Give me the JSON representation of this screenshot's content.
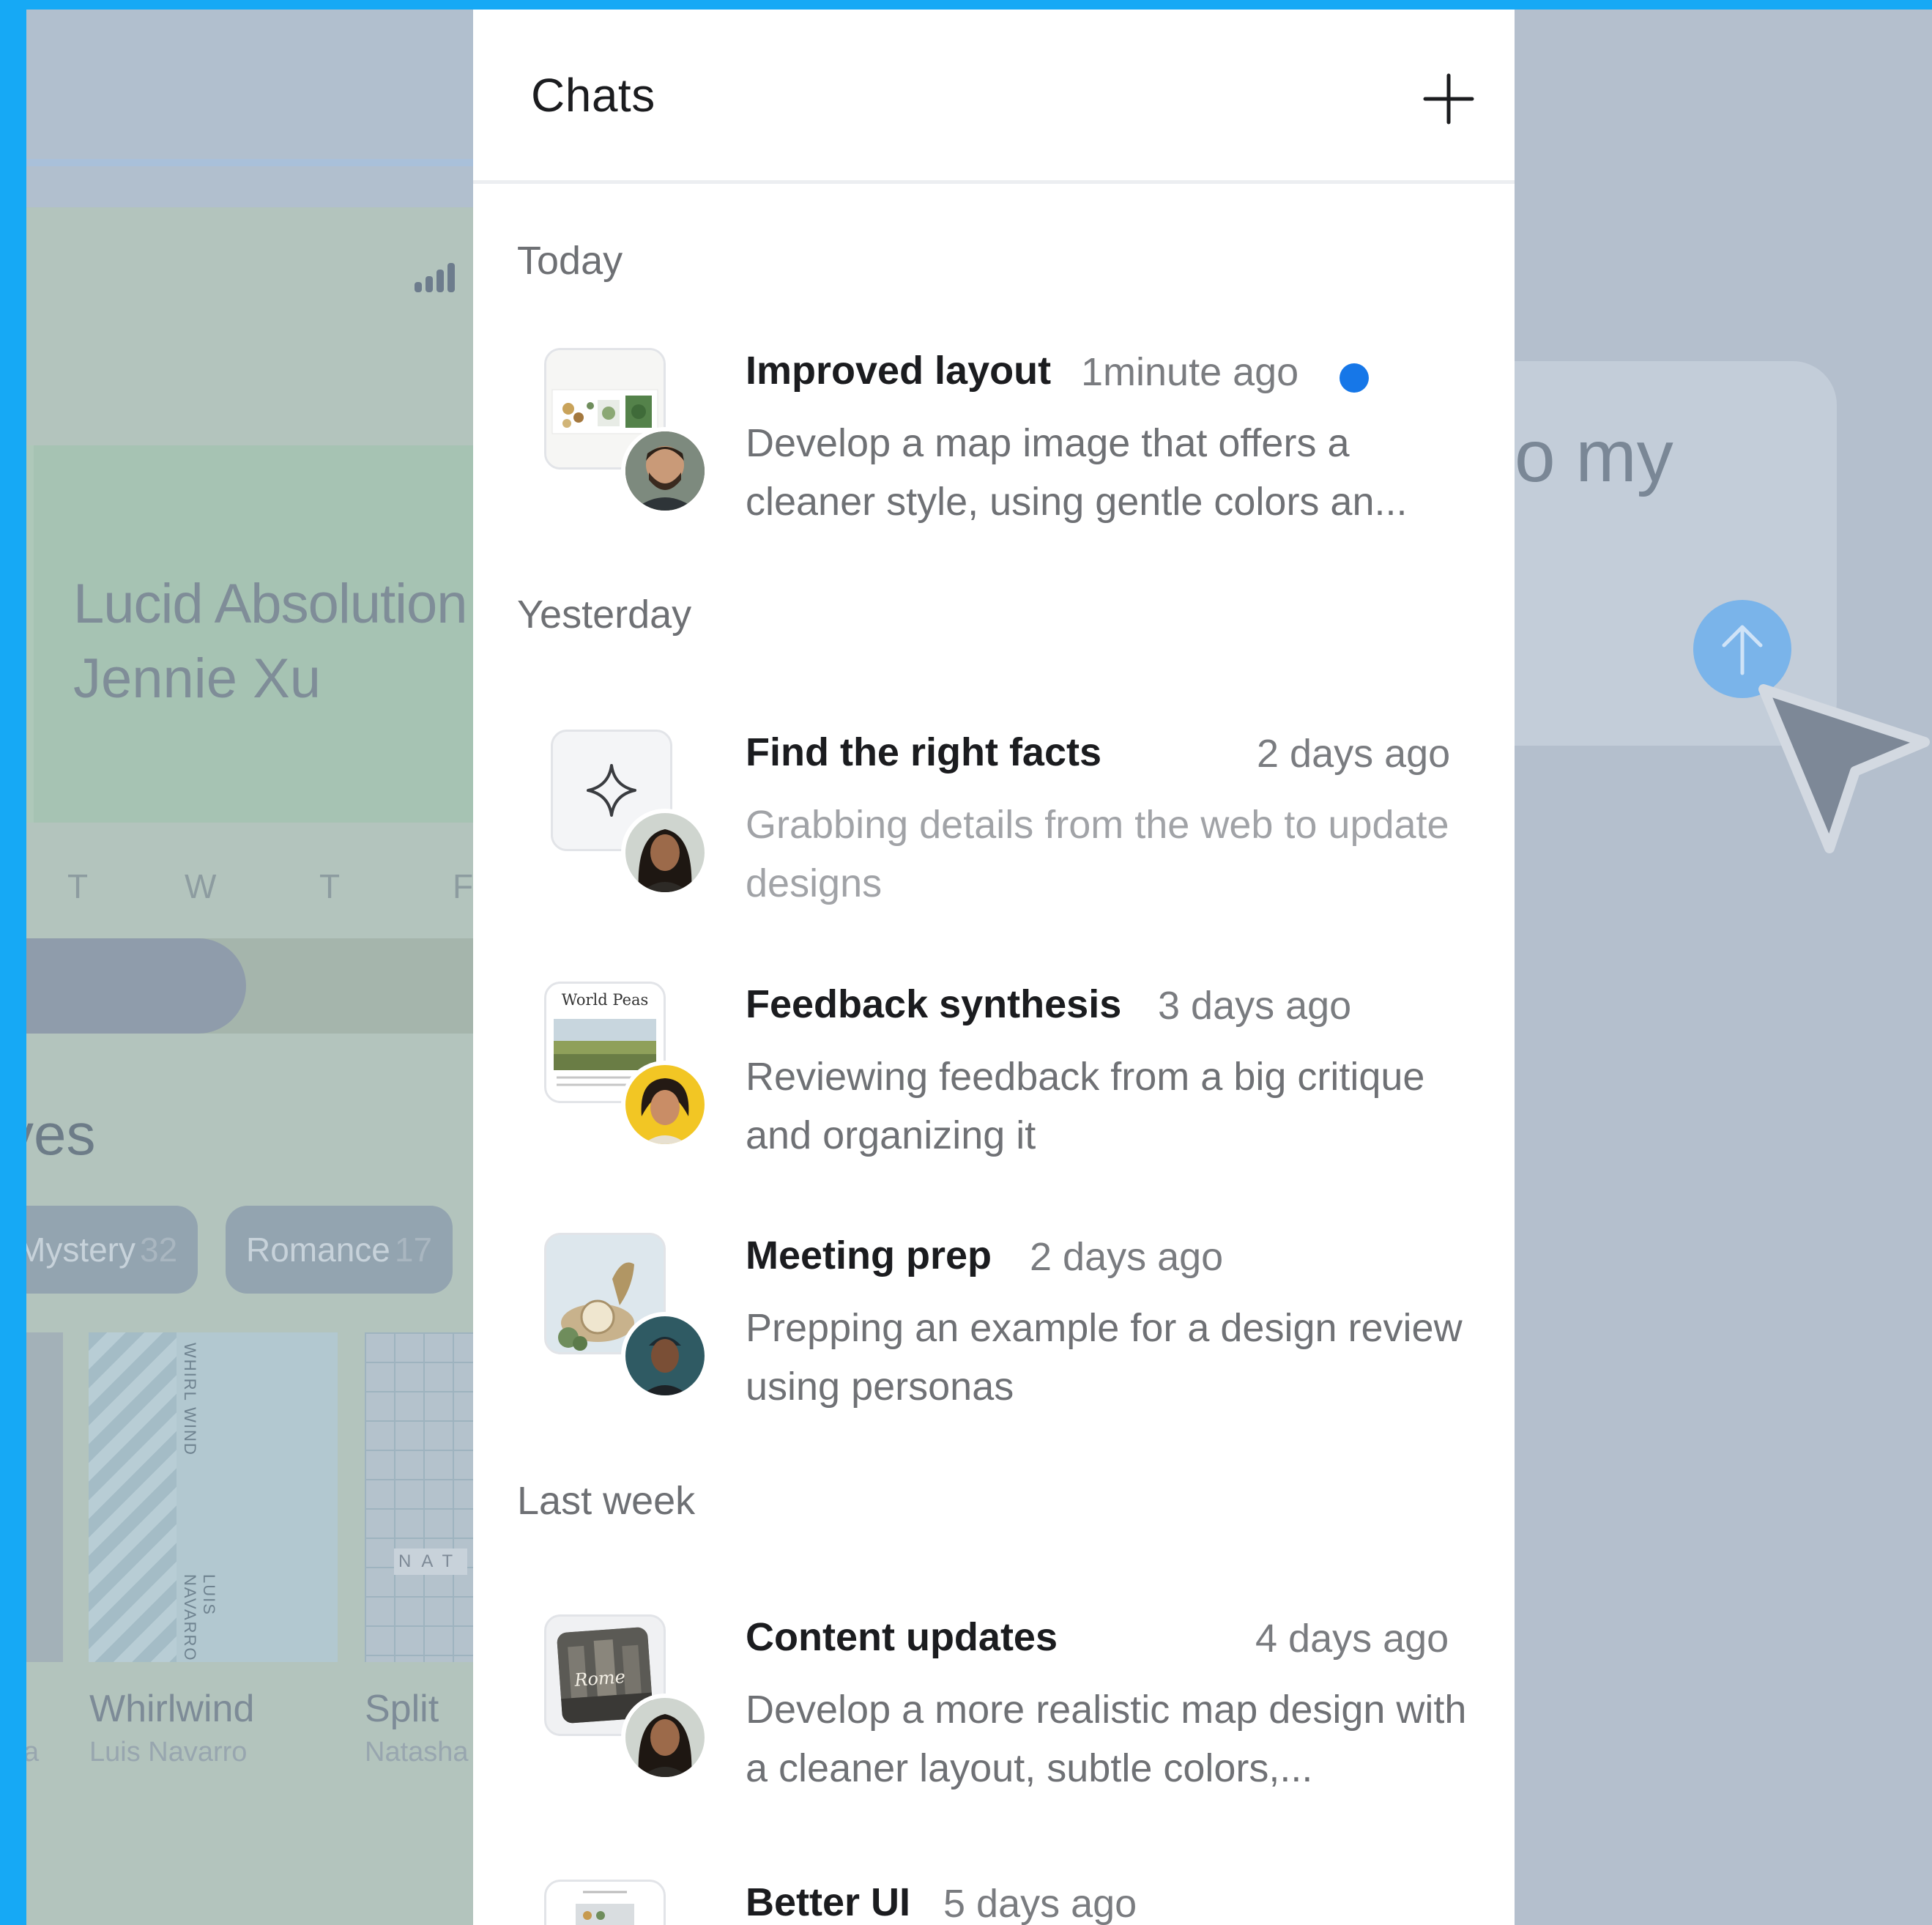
{
  "colors": {
    "frame": "#16a9f5",
    "unread": "#1677e8",
    "panel_bg": "#ffffff",
    "title_text": "#1b1c1f",
    "secondary_text": "#6f7175"
  },
  "background_left": {
    "book_title": "Lucid Absolution",
    "book_author": "Jennie Xu",
    "weekdays": [
      "T",
      "W",
      "T",
      "F"
    ],
    "shelf_heading": "ves",
    "chips": [
      {
        "label": "Mystery",
        "count": "32"
      },
      {
        "label": "Romance",
        "count": "17"
      }
    ],
    "books": [
      {
        "title": "Whirlwind",
        "author": "Luis Navarro",
        "spine_top": "WHIRL WIND",
        "spine_bottom": "LUIS NAVARRO"
      },
      {
        "title": "Split",
        "author": "Natasha",
        "cover_text": "NAT"
      }
    ],
    "left_fragment": "a"
  },
  "background_right": {
    "composer_text": "o my",
    "send_icon": "arrow-up-icon",
    "cursor_icon": "pointer-cursor-icon"
  },
  "panel": {
    "title": "Chats",
    "new_chat_icon": "plus-icon",
    "sections": [
      {
        "label": "Today",
        "items": [
          {
            "title": "Improved layout",
            "time": "1minute ago",
            "unread": true,
            "description": "Develop a map image that offers a cleaner style, using gentle colors an..."
          }
        ]
      },
      {
        "label": "Yesterday",
        "items": [
          {
            "title": "Find the right facts",
            "time": "2 days ago",
            "unread": false,
            "description": "Grabbing details from the web to update designs"
          },
          {
            "title": "Feedback synthesis",
            "time": "3 days ago",
            "unread": false,
            "description": "Reviewing feedback from a big critique and organizing it",
            "thumb_text": "World Peas"
          },
          {
            "title": "Meeting prep",
            "time": "2 days ago",
            "unread": false,
            "description": "Prepping an example for a design review using personas"
          }
        ]
      },
      {
        "label": "Last week",
        "items": [
          {
            "title": "Content updates",
            "time": "4 days ago",
            "unread": false,
            "description": "Develop a more realistic map design with a cleaner layout, subtle colors,...",
            "thumb_text": "Rome"
          },
          {
            "title": "Better UI",
            "time": "5 days ago",
            "unread": false,
            "description": ""
          }
        ]
      }
    ]
  }
}
